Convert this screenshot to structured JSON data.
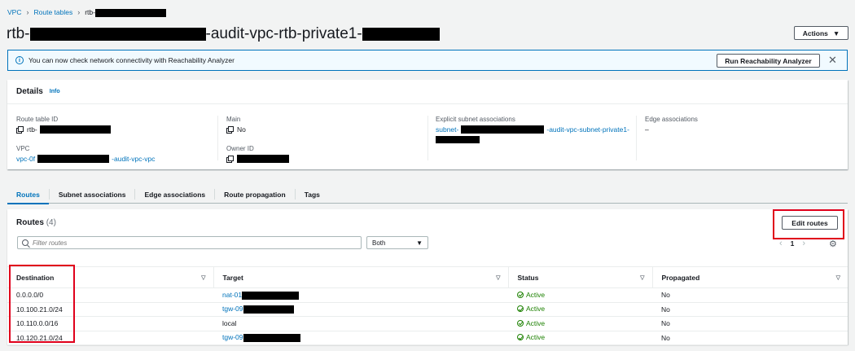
{
  "breadcrumb": {
    "root": "VPC",
    "section": "Route tables",
    "current_prefix": "rtb-"
  },
  "title": {
    "prefix": "rtb-",
    "middle": "-audit-vpc-rtb-private1-"
  },
  "actions_label": "Actions",
  "banner": {
    "message": "You can now check network connectivity with Reachability Analyzer",
    "button": "Run Reachability Analyzer"
  },
  "details": {
    "heading": "Details",
    "info": "Info",
    "route_table_id": {
      "label": "Route table ID",
      "value_prefix": "rtb-"
    },
    "vpc": {
      "label": "VPC",
      "value_prefix": "vpc-0f",
      "value_suffix": "-audit-vpc-vpc"
    },
    "main": {
      "label": "Main",
      "value": "No"
    },
    "owner_id": {
      "label": "Owner ID"
    },
    "explicit_subnet": {
      "label": "Explicit subnet associations",
      "value_prefix": "subnet-",
      "value_suffix": "-audit-vpc-subnet-private1-"
    },
    "edge": {
      "label": "Edge associations",
      "value": "–"
    }
  },
  "tabs": [
    "Routes",
    "Subnet associations",
    "Edge associations",
    "Route propagation",
    "Tags"
  ],
  "routes": {
    "title": "Routes",
    "count": "(4)",
    "edit_button": "Edit routes",
    "filter_placeholder": "Filter routes",
    "select_value": "Both",
    "page": "1",
    "columns": [
      "Destination",
      "Target",
      "Status",
      "Propagated"
    ],
    "rows": [
      {
        "destination": "0.0.0.0/0",
        "target": "nat-01",
        "status": "Active",
        "propagated": "No"
      },
      {
        "destination": "10.100.21.0/24",
        "target": "tgw-09",
        "status": "Active",
        "propagated": "No"
      },
      {
        "destination": "10.110.0.0/16",
        "target": "local",
        "status": "Active",
        "propagated": "No"
      },
      {
        "destination": "10.120.21.0/24",
        "target": "tgw-09",
        "status": "Active",
        "propagated": "No"
      }
    ]
  },
  "colors": {
    "link": "#0073bb",
    "success": "#1d8102",
    "highlight": "#e0001b"
  }
}
